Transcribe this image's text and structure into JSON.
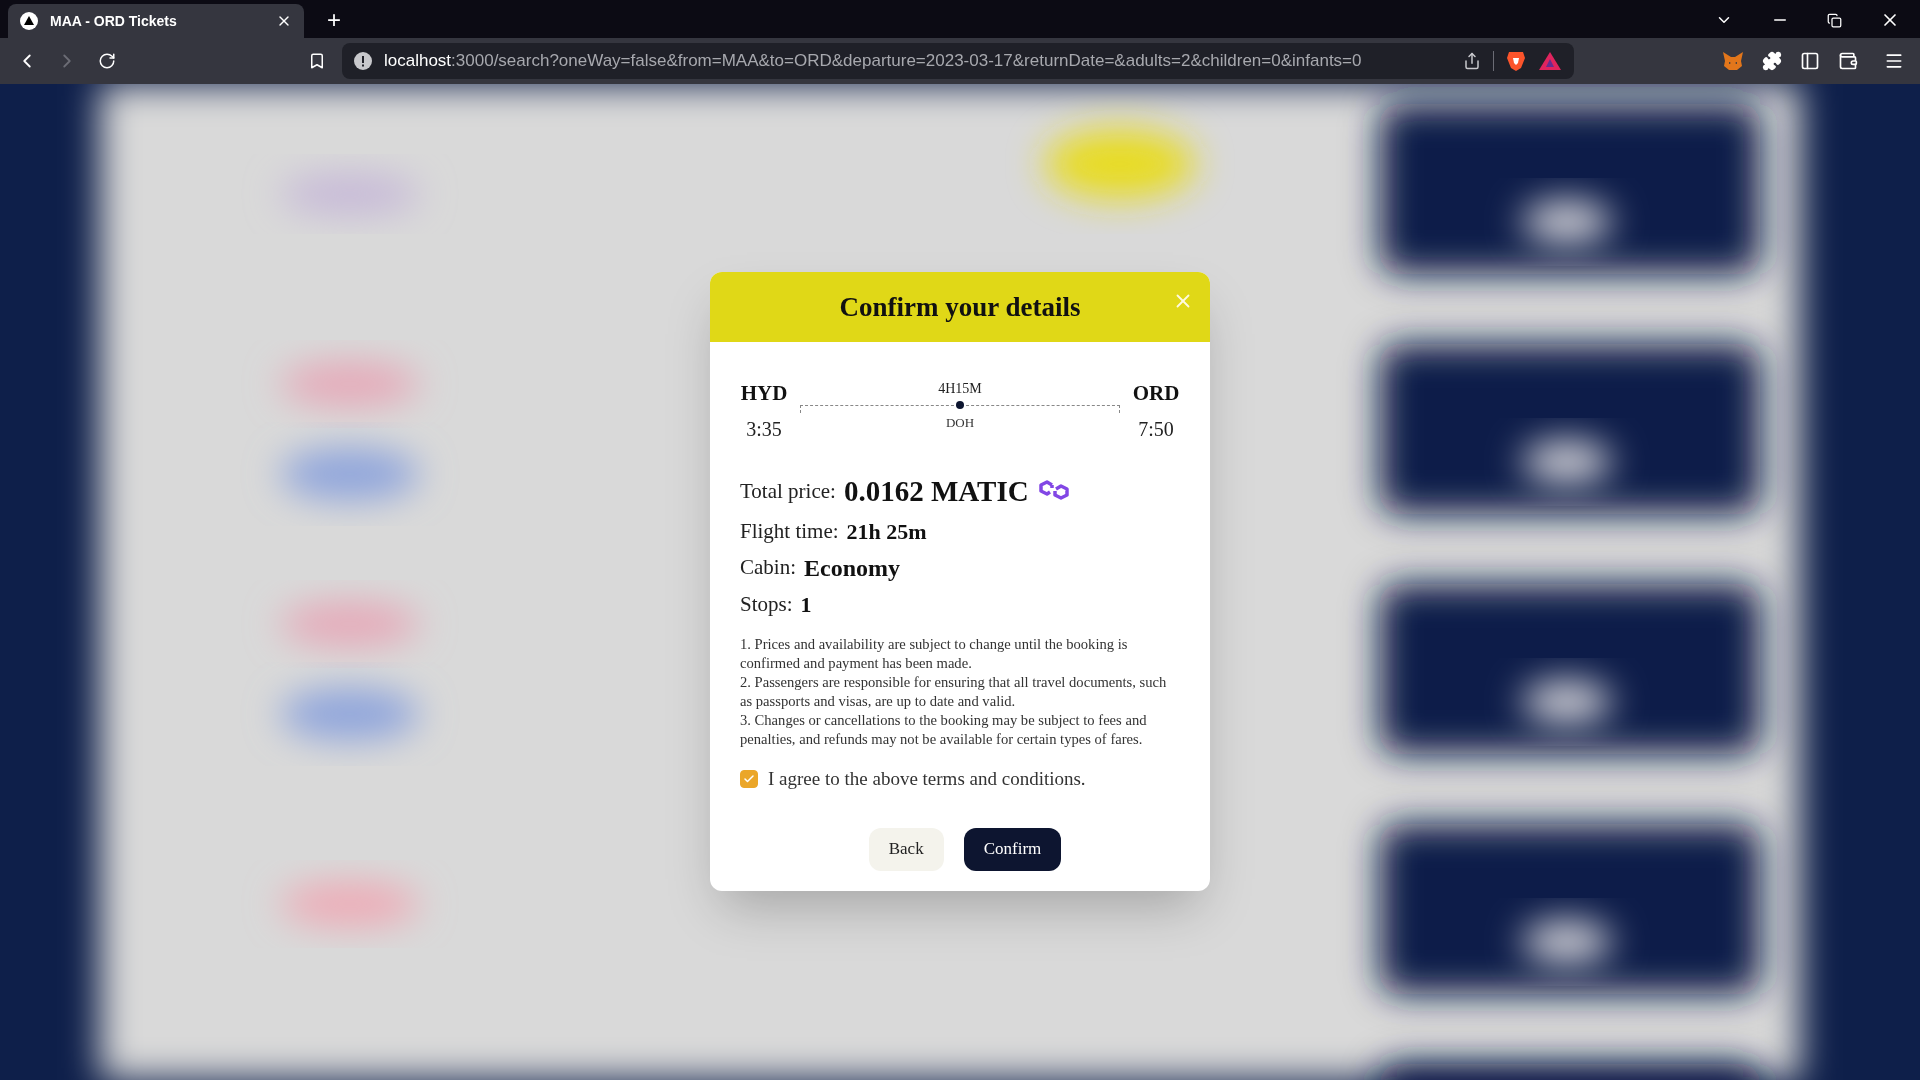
{
  "browser": {
    "tab": {
      "title": "MAA - ORD Tickets",
      "selected": true
    },
    "new_tab": "+",
    "url": {
      "host": "localhost",
      "rest": ":3000/search?oneWay=false&from=MAA&to=ORD&departure=2023-03-17&returnDate=&adults=2&children=0&infants=0"
    }
  },
  "modal": {
    "title": "Confirm your details",
    "route": {
      "from": {
        "code": "HYD",
        "time": "3:35"
      },
      "to": {
        "code": "ORD",
        "time": "7:50"
      },
      "duration": "4H15M",
      "stop": "DOH"
    },
    "details": [
      {
        "kind": "price",
        "label": "Total price:",
        "value": "0.0162 MATIC"
      },
      {
        "kind": "plain",
        "label": "Flight time:",
        "value": "21h 25m"
      },
      {
        "kind": "plain",
        "label": "Cabin:",
        "value": "Economy"
      },
      {
        "kind": "plain",
        "label": "Stops:",
        "value": "1"
      }
    ],
    "terms": [
      "1. Prices and availability are subject to change until the booking is confirmed and payment has been made.",
      "2. Passengers are responsible for ensuring that all travel documents, such as passports and visas, are up to date and valid.",
      "3. Changes or cancellations to the booking may be subject to fees and penalties, and refunds may not be available for certain types of fares."
    ],
    "agree": {
      "label": "I agree to the above terms and conditions.",
      "checked": true
    },
    "buttons": [
      {
        "kind": "secondary",
        "label": "Back"
      },
      {
        "kind": "primary",
        "label": "Confirm"
      }
    ]
  }
}
